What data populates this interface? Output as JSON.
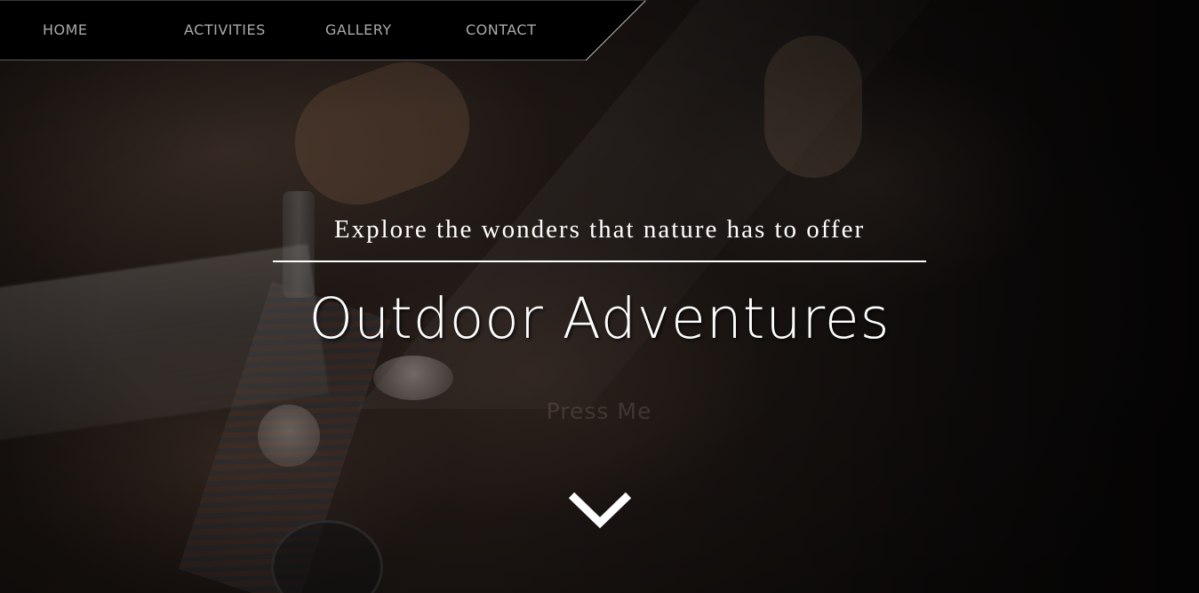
{
  "nav": {
    "items": [
      {
        "label": "HOME"
      },
      {
        "label": "ACTIVITIES"
      },
      {
        "label": "GALLERY"
      },
      {
        "label": "CONTACT"
      }
    ]
  },
  "hero": {
    "tagline": "Explore the wonders that nature has to offer",
    "headline": "Outdoor Adventures",
    "button_label": "Press Me",
    "scroll_icon": "chevron-down-icon"
  },
  "colors": {
    "nav_background": "#000000",
    "nav_text": "#a9a9a9",
    "hero_text": "#ffffff",
    "overlay": "#0b0908"
  }
}
